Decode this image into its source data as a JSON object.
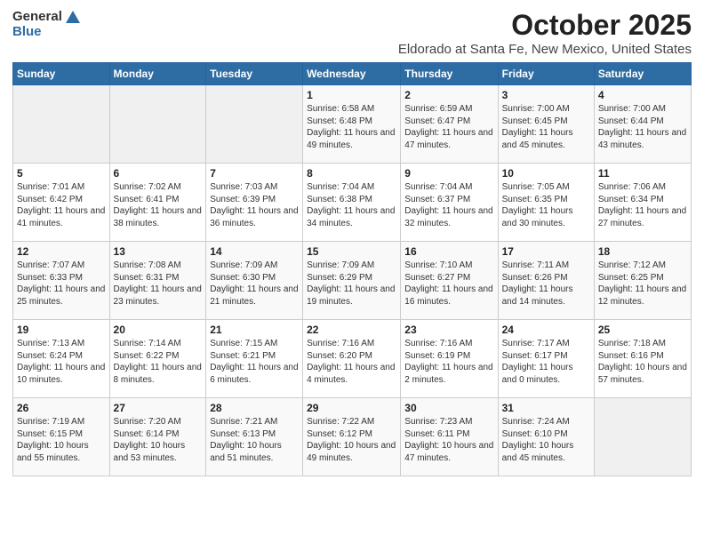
{
  "header": {
    "logo_general": "General",
    "logo_blue": "Blue",
    "title": "October 2025",
    "subtitle": "Eldorado at Santa Fe, New Mexico, United States"
  },
  "weekdays": [
    "Sunday",
    "Monday",
    "Tuesday",
    "Wednesday",
    "Thursday",
    "Friday",
    "Saturday"
  ],
  "weeks": [
    [
      {
        "day": "",
        "sunrise": "",
        "sunset": "",
        "daylight": ""
      },
      {
        "day": "",
        "sunrise": "",
        "sunset": "",
        "daylight": ""
      },
      {
        "day": "",
        "sunrise": "",
        "sunset": "",
        "daylight": ""
      },
      {
        "day": "1",
        "sunrise": "Sunrise: 6:58 AM",
        "sunset": "Sunset: 6:48 PM",
        "daylight": "Daylight: 11 hours and 49 minutes."
      },
      {
        "day": "2",
        "sunrise": "Sunrise: 6:59 AM",
        "sunset": "Sunset: 6:47 PM",
        "daylight": "Daylight: 11 hours and 47 minutes."
      },
      {
        "day": "3",
        "sunrise": "Sunrise: 7:00 AM",
        "sunset": "Sunset: 6:45 PM",
        "daylight": "Daylight: 11 hours and 45 minutes."
      },
      {
        "day": "4",
        "sunrise": "Sunrise: 7:00 AM",
        "sunset": "Sunset: 6:44 PM",
        "daylight": "Daylight: 11 hours and 43 minutes."
      }
    ],
    [
      {
        "day": "5",
        "sunrise": "Sunrise: 7:01 AM",
        "sunset": "Sunset: 6:42 PM",
        "daylight": "Daylight: 11 hours and 41 minutes."
      },
      {
        "day": "6",
        "sunrise": "Sunrise: 7:02 AM",
        "sunset": "Sunset: 6:41 PM",
        "daylight": "Daylight: 11 hours and 38 minutes."
      },
      {
        "day": "7",
        "sunrise": "Sunrise: 7:03 AM",
        "sunset": "Sunset: 6:39 PM",
        "daylight": "Daylight: 11 hours and 36 minutes."
      },
      {
        "day": "8",
        "sunrise": "Sunrise: 7:04 AM",
        "sunset": "Sunset: 6:38 PM",
        "daylight": "Daylight: 11 hours and 34 minutes."
      },
      {
        "day": "9",
        "sunrise": "Sunrise: 7:04 AM",
        "sunset": "Sunset: 6:37 PM",
        "daylight": "Daylight: 11 hours and 32 minutes."
      },
      {
        "day": "10",
        "sunrise": "Sunrise: 7:05 AM",
        "sunset": "Sunset: 6:35 PM",
        "daylight": "Daylight: 11 hours and 30 minutes."
      },
      {
        "day": "11",
        "sunrise": "Sunrise: 7:06 AM",
        "sunset": "Sunset: 6:34 PM",
        "daylight": "Daylight: 11 hours and 27 minutes."
      }
    ],
    [
      {
        "day": "12",
        "sunrise": "Sunrise: 7:07 AM",
        "sunset": "Sunset: 6:33 PM",
        "daylight": "Daylight: 11 hours and 25 minutes."
      },
      {
        "day": "13",
        "sunrise": "Sunrise: 7:08 AM",
        "sunset": "Sunset: 6:31 PM",
        "daylight": "Daylight: 11 hours and 23 minutes."
      },
      {
        "day": "14",
        "sunrise": "Sunrise: 7:09 AM",
        "sunset": "Sunset: 6:30 PM",
        "daylight": "Daylight: 11 hours and 21 minutes."
      },
      {
        "day": "15",
        "sunrise": "Sunrise: 7:09 AM",
        "sunset": "Sunset: 6:29 PM",
        "daylight": "Daylight: 11 hours and 19 minutes."
      },
      {
        "day": "16",
        "sunrise": "Sunrise: 7:10 AM",
        "sunset": "Sunset: 6:27 PM",
        "daylight": "Daylight: 11 hours and 16 minutes."
      },
      {
        "day": "17",
        "sunrise": "Sunrise: 7:11 AM",
        "sunset": "Sunset: 6:26 PM",
        "daylight": "Daylight: 11 hours and 14 minutes."
      },
      {
        "day": "18",
        "sunrise": "Sunrise: 7:12 AM",
        "sunset": "Sunset: 6:25 PM",
        "daylight": "Daylight: 11 hours and 12 minutes."
      }
    ],
    [
      {
        "day": "19",
        "sunrise": "Sunrise: 7:13 AM",
        "sunset": "Sunset: 6:24 PM",
        "daylight": "Daylight: 11 hours and 10 minutes."
      },
      {
        "day": "20",
        "sunrise": "Sunrise: 7:14 AM",
        "sunset": "Sunset: 6:22 PM",
        "daylight": "Daylight: 11 hours and 8 minutes."
      },
      {
        "day": "21",
        "sunrise": "Sunrise: 7:15 AM",
        "sunset": "Sunset: 6:21 PM",
        "daylight": "Daylight: 11 hours and 6 minutes."
      },
      {
        "day": "22",
        "sunrise": "Sunrise: 7:16 AM",
        "sunset": "Sunset: 6:20 PM",
        "daylight": "Daylight: 11 hours and 4 minutes."
      },
      {
        "day": "23",
        "sunrise": "Sunrise: 7:16 AM",
        "sunset": "Sunset: 6:19 PM",
        "daylight": "Daylight: 11 hours and 2 minutes."
      },
      {
        "day": "24",
        "sunrise": "Sunrise: 7:17 AM",
        "sunset": "Sunset: 6:17 PM",
        "daylight": "Daylight: 11 hours and 0 minutes."
      },
      {
        "day": "25",
        "sunrise": "Sunrise: 7:18 AM",
        "sunset": "Sunset: 6:16 PM",
        "daylight": "Daylight: 10 hours and 57 minutes."
      }
    ],
    [
      {
        "day": "26",
        "sunrise": "Sunrise: 7:19 AM",
        "sunset": "Sunset: 6:15 PM",
        "daylight": "Daylight: 10 hours and 55 minutes."
      },
      {
        "day": "27",
        "sunrise": "Sunrise: 7:20 AM",
        "sunset": "Sunset: 6:14 PM",
        "daylight": "Daylight: 10 hours and 53 minutes."
      },
      {
        "day": "28",
        "sunrise": "Sunrise: 7:21 AM",
        "sunset": "Sunset: 6:13 PM",
        "daylight": "Daylight: 10 hours and 51 minutes."
      },
      {
        "day": "29",
        "sunrise": "Sunrise: 7:22 AM",
        "sunset": "Sunset: 6:12 PM",
        "daylight": "Daylight: 10 hours and 49 minutes."
      },
      {
        "day": "30",
        "sunrise": "Sunrise: 7:23 AM",
        "sunset": "Sunset: 6:11 PM",
        "daylight": "Daylight: 10 hours and 47 minutes."
      },
      {
        "day": "31",
        "sunrise": "Sunrise: 7:24 AM",
        "sunset": "Sunset: 6:10 PM",
        "daylight": "Daylight: 10 hours and 45 minutes."
      },
      {
        "day": "",
        "sunrise": "",
        "sunset": "",
        "daylight": ""
      }
    ]
  ]
}
